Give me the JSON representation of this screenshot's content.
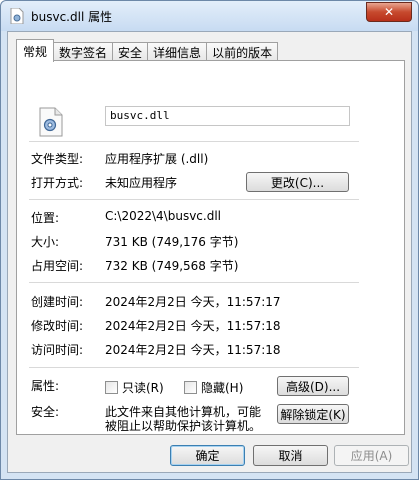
{
  "window": {
    "title": "busvc.dll 属性",
    "close_glyph": "✕"
  },
  "tabs": [
    "常规",
    "数字签名",
    "安全",
    "详细信息",
    "以前的版本"
  ],
  "general": {
    "filename": "busvc.dll",
    "filetype_label": "文件类型:",
    "filetype_value": "应用程序扩展 (.dll)",
    "openwith_label": "打开方式:",
    "openwith_value": "未知应用程序",
    "change_button": "更改(C)...",
    "location_label": "位置:",
    "location_value": "C:\\2022\\4\\busvc.dll",
    "size_label": "大小:",
    "size_value": "731 KB (749,176 字节)",
    "disksize_label": "占用空间:",
    "disksize_value": "732 KB (749,568 字节)",
    "created_label": "创建时间:",
    "created_value": "2024年2月2日 今天，11:57:17",
    "modified_label": "修改时间:",
    "modified_value": "2024年2月2日 今天，11:57:18",
    "accessed_label": "访问时间:",
    "accessed_value": "2024年2月2日 今天，11:57:18",
    "attributes_label": "属性:",
    "readonly_label": "只读(R)",
    "hidden_label": "隐藏(H)",
    "advanced_button": "高级(D)...",
    "security_label": "安全:",
    "security_text_line1": "此文件来自其他计算机，可能",
    "security_text_line2": "被阻止以帮助保护该计算机。",
    "unblock_button": "解除锁定(K)"
  },
  "footer": {
    "ok": "确定",
    "cancel": "取消",
    "apply": "应用(A)"
  }
}
